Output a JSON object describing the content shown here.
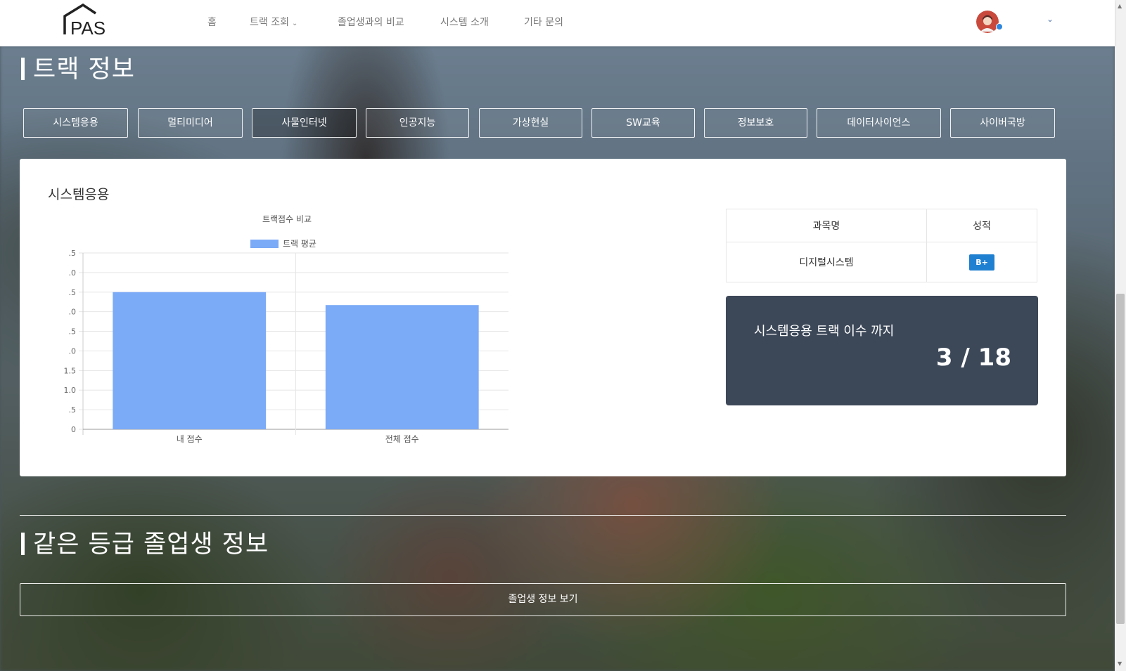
{
  "nav": {
    "logo_text": "PAS",
    "items": [
      {
        "label": "홈"
      },
      {
        "label": "트랙 조회",
        "has_dropdown": true
      },
      {
        "label": "졸업생과의 비교"
      },
      {
        "label": "시스템 소개"
      },
      {
        "label": "기타 문의"
      }
    ]
  },
  "track_section": {
    "title": "트랙 정보",
    "tabs": [
      "시스템응용",
      "멀티미디어",
      "사물인터넷",
      "인공지능",
      "가상현실",
      "SW교육",
      "정보보호",
      "데이터사이언스",
      "사이버국방"
    ],
    "active_tab": "사물인터넷"
  },
  "card": {
    "title": "시스템응용",
    "table": {
      "headers": [
        "과목명",
        "성적"
      ],
      "rows": [
        {
          "course": "디지털시스템",
          "grade": "B+"
        }
      ]
    },
    "progress": {
      "label": "시스템응용 트랙 이수 까지",
      "value": "3 / 18"
    }
  },
  "chart_data": {
    "type": "bar",
    "title": "트랙점수 비교",
    "categories": [
      "내 점수",
      "전체 점수"
    ],
    "series": [
      {
        "name": "트랙 평균",
        "values": [
          3.5,
          3.17
        ],
        "color": "#7baaf7"
      }
    ],
    "ylim": [
      0,
      4.5
    ],
    "yticks": [
      0,
      0.5,
      1.0,
      1.5,
      2.0,
      2.5,
      3.0,
      3.5,
      4.0,
      4.5
    ],
    "ytick_labels": [
      "0",
      ".5",
      "1.0",
      "1.5",
      ".0",
      ".5",
      ".0",
      ".5",
      ".0",
      ".5"
    ],
    "legend_position": "top",
    "grid": true
  },
  "graduate_section": {
    "title": "같은 등급 졸업생 정보",
    "button_label": "졸업생 정보 보기"
  },
  "colors": {
    "header_bg": "#ffffff",
    "card_bg": "#ffffff",
    "progress_bg": "#3c4858",
    "badge": "#1f7fd1",
    "bar": "#7baaf7"
  }
}
